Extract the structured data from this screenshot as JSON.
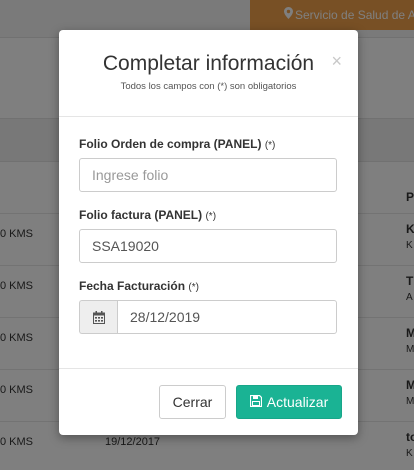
{
  "background": {
    "top_button_label": "Servicio de Salud de A",
    "rows": [
      {
        "left": "0 KMS",
        "right_a": "K",
        "right_b": "K"
      },
      {
        "left": "0 KMS",
        "right_a": "T",
        "right_b": "A"
      },
      {
        "left": "0 KMS",
        "right_a": "M",
        "right_b": "M"
      },
      {
        "left": "0 KMS",
        "right_a": "M",
        "right_b": "M"
      },
      {
        "left": "0 KMS",
        "date": "19/12/2017",
        "right_a": "to",
        "right_b": "K"
      }
    ],
    "column_head": "P"
  },
  "modal": {
    "title": "Completar información",
    "subtitle": "Todos los campos con (*) son obligatorios",
    "fields": {
      "folio_orden": {
        "label": "Folio Orden de compra (PANEL)",
        "required": "(*)",
        "placeholder": "Ingrese folio",
        "value": ""
      },
      "folio_factura": {
        "label": "Folio factura (PANEL)",
        "required": "(*)",
        "value": "SSA19020"
      },
      "fecha": {
        "label": "Fecha Facturación",
        "required": "(*)",
        "value": "28/12/2019"
      }
    },
    "buttons": {
      "close": "Cerrar",
      "update": "Actualizar"
    }
  },
  "icons": {
    "close": "close-icon",
    "calendar": "calendar-icon",
    "save": "save-icon",
    "map_marker": "map-marker-icon"
  },
  "colors": {
    "accent": "#1ab394",
    "orange": "#f0a14a"
  }
}
